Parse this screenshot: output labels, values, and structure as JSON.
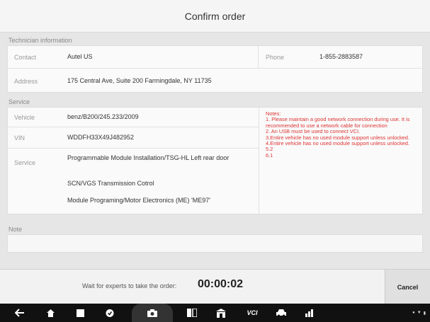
{
  "header": {
    "title": "Confirm order"
  },
  "technician": {
    "section_label": "Technician information",
    "contact_label": "Contact",
    "contact_value": "Autel US",
    "phone_label": "Phone",
    "phone_value": "1-855-2883587",
    "address_label": "Address",
    "address_value": "175 Central Ave, Suite 200 Farmingdale, NY 11735"
  },
  "service": {
    "section_label": "Service",
    "vehicle_label": "Vehicle",
    "vehicle_value": "benz/B200/245.233/2009",
    "vin_label": "VIN",
    "vin_value": "WDDFH33X49J482952",
    "service_label": "Service",
    "service_items": [
      "Programmable Module Installation/TSG-HL Left rear door",
      "SCN/VGS Transmission Cotrol",
      "Module Programing/Motor Electronics (ME) 'ME97'"
    ],
    "notes": [
      "Notes:",
      "1. Please maintain a good network connection during use. It is recommended to use a network cable for connection",
      "2. An USB must be used to connect VCI.",
      "3.Entire vehicle has no used module support unless unlocked.",
      "4.Entire vehicle has no used module support unless unlocked.",
      "5.2",
      "6.1"
    ],
    "notes_color": "#dd3333"
  },
  "note": {
    "section_label": "Note"
  },
  "footer": {
    "wait_label": "Wait for experts to take the order:",
    "timer": "00:00:02",
    "cancel_label": "Cancel"
  },
  "navbar": {
    "icons": [
      "back-icon",
      "home-icon",
      "recent-apps-icon",
      "shield-icon",
      "camera-icon",
      "display-icon",
      "dealership-icon",
      "vci-icon",
      "car-icon",
      "network-icon"
    ],
    "vci_label": "VCI"
  }
}
